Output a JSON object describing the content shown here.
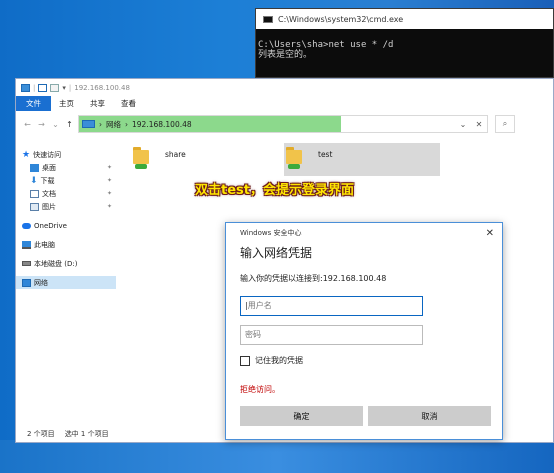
{
  "cmd": {
    "title": "C:\\Windows\\system32\\cmd.exe",
    "line1": "C:\\Users\\sha>net use * /d",
    "line2": "列表是空的。"
  },
  "explorer": {
    "title": "192.168.100.48",
    "ribbon": {
      "file": "文件",
      "home": "主页",
      "share": "共享",
      "view": "查看"
    },
    "address": {
      "root": "网络",
      "host": "192.168.100.48"
    },
    "sidebar": {
      "quick_access": "快速访问",
      "desktop": "桌面",
      "downloads": "下载",
      "documents": "文档",
      "pictures": "图片",
      "onedrive": "OneDrive",
      "this_pc": "此电脑",
      "local_disk": "本地磁盘 (D:)",
      "network": "网络"
    },
    "items": [
      {
        "name": "share"
      },
      {
        "name": "test"
      }
    ],
    "status": {
      "count": "2 个项目",
      "selected": "选中 1 个项目"
    }
  },
  "annotation": "双击test，会提示登录界面",
  "dialog": {
    "window_title": "Windows 安全中心",
    "heading": "输入网络凭据",
    "description": "输入你的凭据以连接到:192.168.100.48",
    "username_placeholder": "用户名",
    "password_placeholder": "密码",
    "remember": "记住我的凭据",
    "error": "拒绝访问。",
    "ok": "确定",
    "cancel": "取消"
  },
  "colors": {
    "address_highlight": "#8cd98c",
    "accent": "#1a6fd1",
    "error": "#c00000",
    "annotation": "#ffe600"
  }
}
